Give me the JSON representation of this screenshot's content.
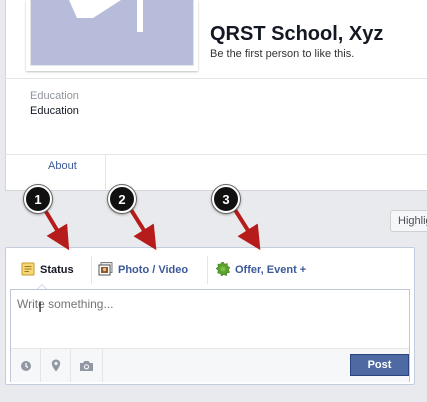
{
  "page": {
    "title": "QRST School, Xyz",
    "like_prompt": "Be the first person to like this.",
    "category_label": "Education",
    "category_value": "Education",
    "about_link": "About",
    "highlights_button": "Highlights"
  },
  "composer": {
    "tabs": [
      {
        "label": "Status",
        "icon": "status-note-icon"
      },
      {
        "label": "Photo / Video",
        "icon": "photo-icon"
      },
      {
        "label": "Offer, Event +",
        "icon": "offer-badge-icon"
      }
    ],
    "placeholder": "Write something...",
    "footer_icons": [
      "clock-icon",
      "location-pin-icon",
      "camera-icon"
    ],
    "post_label": "Post"
  },
  "annotations": {
    "badges": [
      "1",
      "2",
      "3"
    ],
    "arrow_color": "#b71c1c"
  },
  "colors": {
    "link": "#3b5998",
    "post_button": "#4f6aa3",
    "profile_placeholder": "#b6bcd9"
  }
}
